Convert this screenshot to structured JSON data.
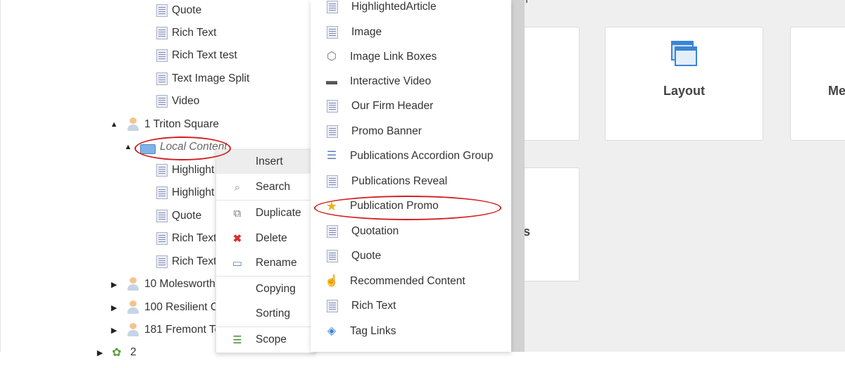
{
  "tree": {
    "items": [
      {
        "label": "Quote",
        "icon": "document-icon"
      },
      {
        "label": "Rich Text",
        "icon": "document-icon"
      },
      {
        "label": "Rich Text test",
        "icon": "document-icon"
      },
      {
        "label": "Text Image Split",
        "icon": "document-icon"
      },
      {
        "label": "Video",
        "icon": "document-icon"
      },
      {
        "label": "1 Triton Square",
        "icon": "person-icon",
        "toggle": "▲"
      },
      {
        "label": "Local Content",
        "icon": "folder-icon",
        "toggle": "▲"
      },
      {
        "label": "Highlight",
        "icon": "document-icon"
      },
      {
        "label": "Highlight",
        "icon": "document-icon"
      },
      {
        "label": "Quote",
        "icon": "document-icon"
      },
      {
        "label": "Rich Text",
        "icon": "document-icon"
      },
      {
        "label": "Rich Text",
        "icon": "document-icon"
      },
      {
        "label": "10 Molesworth",
        "icon": "person-icon",
        "toggle": "▶"
      },
      {
        "label": "100 Resilient Ci",
        "icon": "person-icon",
        "toggle": "▶"
      },
      {
        "label": "181 Fremont To",
        "icon": "person-icon",
        "toggle": "▶"
      },
      {
        "label": "2",
        "icon": "tree-icon",
        "toggle": "▶"
      }
    ]
  },
  "context_menu": {
    "items": [
      {
        "label": "Insert",
        "icon": ""
      },
      {
        "label": "Search",
        "icon": "🔍"
      },
      {
        "label": "Duplicate",
        "icon": "⧉"
      },
      {
        "label": "Delete",
        "icon": "✖"
      },
      {
        "label": "Rename",
        "icon": "▭"
      },
      {
        "label": "Copying",
        "icon": ""
      },
      {
        "label": "Sorting",
        "icon": ""
      },
      {
        "label": "Scope",
        "icon": "☰"
      }
    ]
  },
  "insert_submenu": {
    "items": [
      {
        "label": "HighlightedArticle",
        "icon": "document-icon"
      },
      {
        "label": "Image",
        "icon": "document-icon"
      },
      {
        "label": "Image Link Boxes",
        "icon": "cube-icon"
      },
      {
        "label": "Interactive Video",
        "icon": "video-icon"
      },
      {
        "label": "Our Firm Header",
        "icon": "document-icon"
      },
      {
        "label": "Promo Banner",
        "icon": "document-icon"
      },
      {
        "label": "Publications Accordion Group",
        "icon": "list-icon"
      },
      {
        "label": "Publications Reveal",
        "icon": "document-icon"
      },
      {
        "label": "Publication Promo",
        "icon": "star-icon"
      },
      {
        "label": "Quotation",
        "icon": "document-icon"
      },
      {
        "label": "Quote",
        "icon": "document-icon"
      },
      {
        "label": "Recommended Content",
        "icon": "thumb-icon"
      },
      {
        "label": "Rich Text",
        "icon": "document-icon"
      },
      {
        "label": "Tag Links",
        "icon": "tag-icon"
      }
    ]
  },
  "workspace": {
    "header_fragment": "l",
    "tiles": [
      {
        "label": ""
      },
      {
        "label": "Layout"
      },
      {
        "label": "Me"
      },
      {
        "label": "s"
      }
    ]
  },
  "colors": {
    "highlight_ellipse": "#d21f1f",
    "menu_hover": "#ededed",
    "workspace_bg": "#efefef"
  }
}
